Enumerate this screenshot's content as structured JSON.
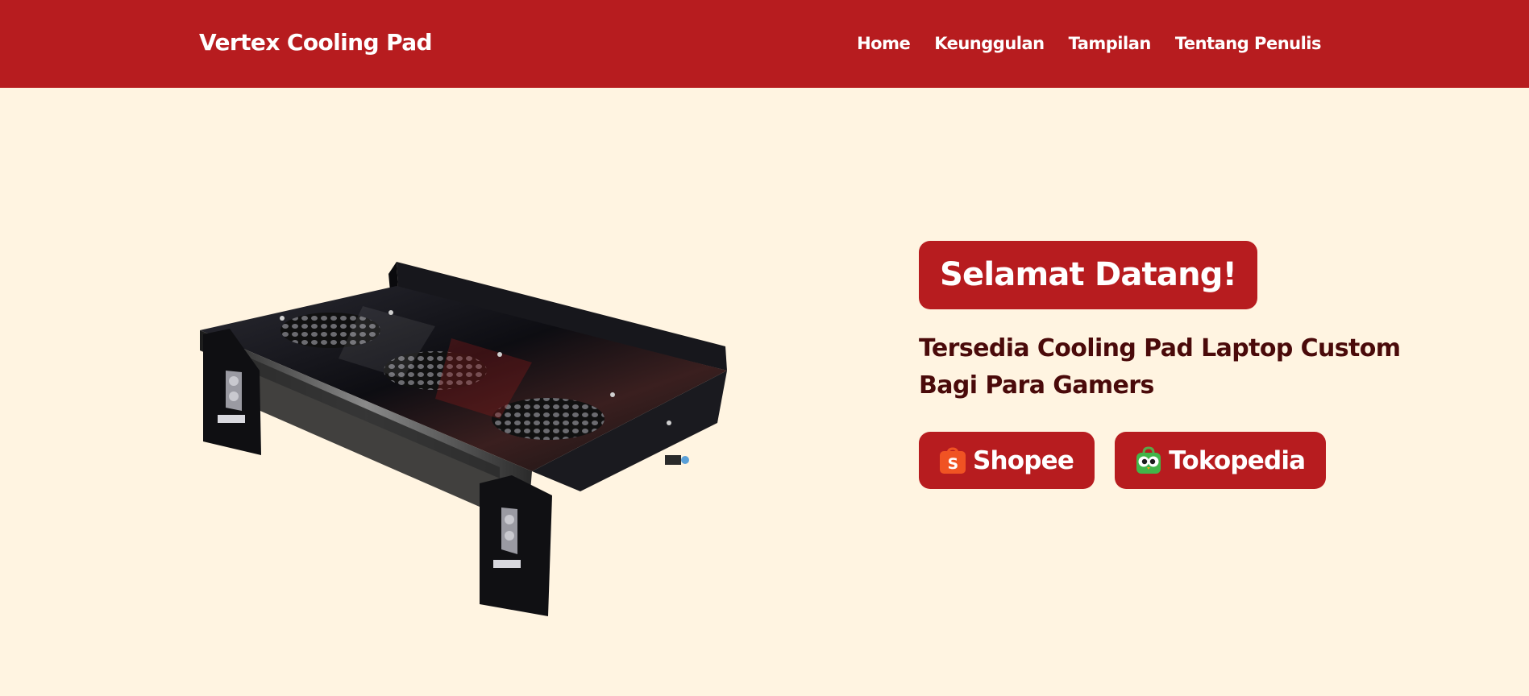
{
  "header": {
    "brand": "Vertex Cooling Pad",
    "nav": [
      "Home",
      "Keunggulan",
      "Tampilan",
      "Tentang Penulis"
    ]
  },
  "hero": {
    "welcome": "Selamat Datang!",
    "subtitle": "Tersedia Cooling Pad Laptop Custom Bagi Para Gamers",
    "image_icon": "cooling-pad-product-image",
    "buttons": [
      {
        "label": "Shopee",
        "icon": "shopee-icon"
      },
      {
        "label": "Tokopedia",
        "icon": "tokopedia-icon"
      }
    ]
  },
  "colors": {
    "primary": "#b71c1f",
    "background": "#fff4e1",
    "text_dark": "#4a0a0a",
    "on_primary": "#ffffff"
  }
}
